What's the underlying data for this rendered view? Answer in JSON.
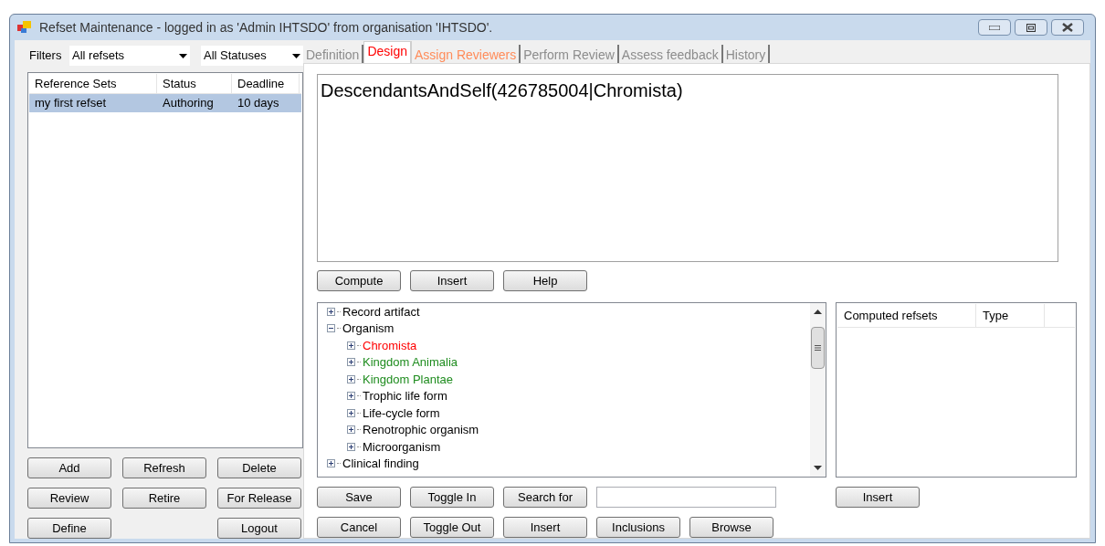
{
  "window": {
    "title": "Refset Maintenance - logged in as 'Admin IHTSDO' from organisation 'IHTSDO'."
  },
  "filters": {
    "label": "Filters",
    "refset_filter": "All refsets",
    "status_filter": "All Statuses"
  },
  "refset_list": {
    "columns": [
      "Reference Sets",
      "Status",
      "Deadline"
    ],
    "rows": [
      {
        "cells": [
          "my first refset",
          "Authoring",
          "10 days"
        ],
        "selected": true
      }
    ]
  },
  "left_buttons": [
    [
      {
        "kind": "button",
        "label": "Add"
      },
      {
        "kind": "button",
        "label": "Refresh"
      },
      {
        "kind": "button",
        "label": "Delete"
      }
    ],
    [
      {
        "kind": "button",
        "label": "Review"
      },
      {
        "kind": "button",
        "label": "Retire"
      },
      {
        "kind": "button",
        "label": "For Release"
      }
    ],
    [
      {
        "kind": "button",
        "label": "Define"
      },
      {
        "kind": "spacer"
      },
      {
        "kind": "button",
        "label": "Logout"
      }
    ]
  ],
  "tabs": [
    {
      "label": "Definition",
      "selected": false,
      "color": "#8c8c8c"
    },
    {
      "label": "Design",
      "selected": true,
      "color": "#ff0000"
    },
    {
      "label": "Assign Reviewers",
      "selected": false,
      "color": "#ff8c5a"
    },
    {
      "label": "Perform Review",
      "selected": false,
      "color": "#8c8c8c"
    },
    {
      "label": "Assess feedback",
      "selected": false,
      "color": "#8c8c8c"
    },
    {
      "label": "History",
      "selected": false,
      "color": "#8c8c8c"
    }
  ],
  "definition": "DescendantsAndSelf(426785004|Chromista)",
  "definition_buttons": [
    "Compute",
    "Insert",
    "Help"
  ],
  "tree": [
    {
      "label": "Record artifact",
      "expanded": false,
      "color": "#000000"
    },
    {
      "label": "Organism",
      "expanded": true,
      "color": "#000000",
      "children": [
        {
          "label": "Chromista",
          "expanded": false,
          "color": "#ff0000"
        },
        {
          "label": "Kingdom Animalia",
          "expanded": false,
          "color": "#1e8c1e"
        },
        {
          "label": "Kingdom Plantae",
          "expanded": false,
          "color": "#1e8c1e"
        },
        {
          "label": "Trophic life form",
          "expanded": false,
          "color": "#000000"
        },
        {
          "label": "Life-cycle form",
          "expanded": false,
          "color": "#000000"
        },
        {
          "label": "Renotrophic organism",
          "expanded": false,
          "color": "#000000"
        },
        {
          "label": "Microorganism",
          "expanded": false,
          "color": "#000000"
        }
      ]
    },
    {
      "label": "Clinical finding",
      "expanded": false,
      "color": "#000000"
    }
  ],
  "computed_list": {
    "columns": [
      "Computed refsets",
      "Type"
    ],
    "insert_button": "Insert"
  },
  "bottom_buttons": [
    [
      {
        "label": "Save",
        "kind": "button"
      },
      {
        "label": "Toggle In",
        "kind": "button"
      },
      {
        "label": "Search for",
        "kind": "button"
      },
      {
        "kind": "field"
      }
    ],
    [
      {
        "label": "Cancel",
        "kind": "button"
      },
      {
        "label": "Toggle Out",
        "kind": "button"
      },
      {
        "label": "Insert",
        "kind": "button"
      },
      {
        "label": "Inclusions",
        "kind": "button"
      },
      {
        "label": "Browse",
        "kind": "button"
      }
    ]
  ]
}
